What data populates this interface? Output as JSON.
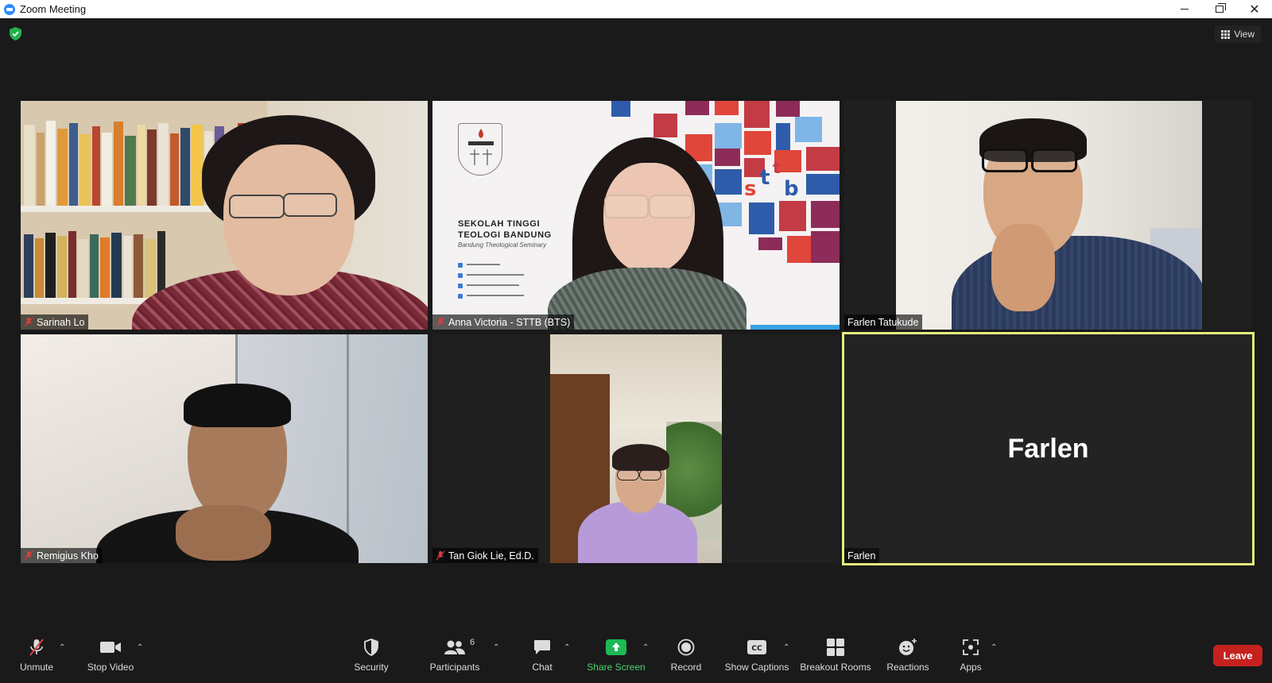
{
  "window": {
    "title": "Zoom Meeting"
  },
  "header": {
    "view_label": "View"
  },
  "participants": [
    {
      "name": "Sarinah Lo",
      "muted": true
    },
    {
      "name": "Anna Victoria - STTB (BTS)",
      "muted": true
    },
    {
      "name": "Farlen Tatukude",
      "muted": false
    },
    {
      "name": "Remigius Kho",
      "muted": true
    },
    {
      "name": "Tan Giok Lie, Ed.D.",
      "muted": true
    },
    {
      "name": "Farlen",
      "muted": false,
      "video_off": true,
      "display_name": "Farlen",
      "active_speaker": true
    }
  ],
  "slide": {
    "title_line1": "SEKOLAH TINGGI",
    "title_line2": "TEOLOGI BANDUNG",
    "subtitle": "Bandung Theological Seminary",
    "logo_text": "sttb"
  },
  "toolbar": {
    "unmute": "Unmute",
    "stop_video": "Stop Video",
    "security": "Security",
    "participants": "Participants",
    "participants_count": "6",
    "chat": "Chat",
    "share_screen": "Share Screen",
    "record": "Record",
    "show_captions": "Show Captions",
    "breakout_rooms": "Breakout Rooms",
    "reactions": "Reactions",
    "apps": "Apps",
    "leave": "Leave"
  },
  "colors": {
    "active_speaker_border": "#e5f07c",
    "share_green": "#49d36b",
    "leave_red": "#c5221f",
    "app_blue": "#2d8cff"
  }
}
